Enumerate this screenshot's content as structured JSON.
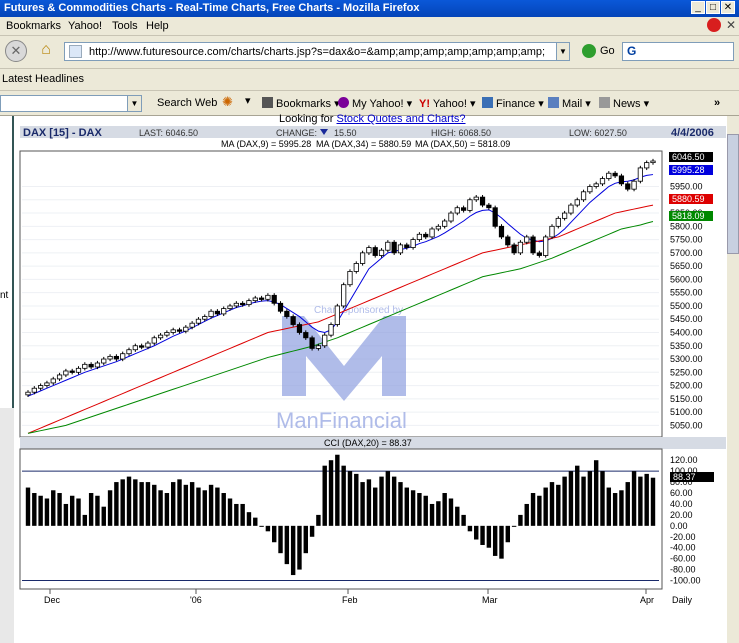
{
  "window": {
    "title": "Futures & Commodities Charts - Real-Time Charts, Free Charts - Mozilla Firefox"
  },
  "menu": {
    "items": [
      "Bookmarks",
      "Yahoo!",
      "Tools",
      "Help"
    ]
  },
  "nav": {
    "url": "http://www.futuresource.com/charts/charts.jsp?s=dax&o=&amp;amp;amp;amp;amp;amp;amp;amp;amp;a=D",
    "go_label": "Go"
  },
  "headlines": {
    "label": "Latest Headlines"
  },
  "yahoo_toolbar": {
    "search_web": "Search Web",
    "bookmarks": "Bookmarks",
    "my_yahoo": "My Yahoo!",
    "yahoo": "Yahoo!",
    "finance": "Finance",
    "mail": "Mail",
    "news": "News",
    "more": "»"
  },
  "page": {
    "looking_prefix": "Looking for",
    "looking_link": "Stock Quotes and Charts?",
    "left_fragment": "nt"
  },
  "colors": {
    "ma9": "#0000dd",
    "ma34": "#dd0000",
    "ma50": "#008800",
    "cci": "#000000",
    "watermark": "#8fa0e0"
  },
  "watermark": {
    "line1": "Chart Sponsored by",
    "line2": "ManFinancial"
  },
  "chart_data": {
    "type": "candlestick",
    "symbol": "DAX [15] - DAX",
    "last": "LAST: 6046.50",
    "change": "CHANGE:",
    "change_value": "15.50",
    "high": "HIGH: 6068.50",
    "low": "LOW: 6027.50",
    "date": "4/4/2006",
    "ma_legend": [
      {
        "label": "MA (DAX,9) = 5995.28",
        "color": "#0000dd"
      },
      {
        "label": "MA (DAX,34) = 5880.59",
        "color": "#dd0000"
      },
      {
        "label": "MA (DAX,50) = 5818.09",
        "color": "#008800"
      }
    ],
    "price_axis": [
      "5950.00",
      "5900.00",
      "5850.00",
      "5800.00",
      "5750.00",
      "5700.00",
      "5650.00",
      "5600.00",
      "5550.00",
      "5500.00",
      "5450.00",
      "5400.00",
      "5350.00",
      "5300.00",
      "5250.00",
      "5200.00",
      "5150.00",
      "5100.00",
      "5050.00"
    ],
    "price_badges": [
      {
        "label": "6046.50",
        "bg": "#000000",
        "fg": "#ffffff"
      },
      {
        "label": "5995.28",
        "bg": "#0000dd",
        "fg": "#ffffff"
      },
      {
        "label": "5880.59",
        "bg": "#dd0000",
        "fg": "#ffffff"
      },
      {
        "label": "5818.09",
        "bg": "#008800",
        "fg": "#ffffff"
      }
    ],
    "ylim": [
      5010,
      6080
    ],
    "close": [
      5175,
      5190,
      5200,
      5210,
      5225,
      5240,
      5255,
      5250,
      5265,
      5280,
      5270,
      5285,
      5300,
      5310,
      5300,
      5320,
      5335,
      5350,
      5345,
      5360,
      5380,
      5390,
      5400,
      5410,
      5405,
      5420,
      5435,
      5450,
      5460,
      5480,
      5470,
      5490,
      5500,
      5510,
      5505,
      5520,
      5530,
      5525,
      5540,
      5510,
      5480,
      5460,
      5430,
      5400,
      5380,
      5340,
      5350,
      5390,
      5430,
      5500,
      5580,
      5630,
      5660,
      5700,
      5720,
      5690,
      5710,
      5740,
      5700,
      5730,
      5720,
      5750,
      5770,
      5760,
      5790,
      5800,
      5820,
      5850,
      5870,
      5860,
      5900,
      5910,
      5880,
      5870,
      5800,
      5760,
      5730,
      5700,
      5740,
      5760,
      5700,
      5690,
      5760,
      5800,
      5830,
      5850,
      5880,
      5900,
      5930,
      5950,
      5960,
      5980,
      6000,
      5990,
      5960,
      5940,
      5970,
      6020,
      6040,
      6046
    ],
    "ma9": [
      5160,
      5170,
      5180,
      5190,
      5200,
      5210,
      5220,
      5230,
      5240,
      5250,
      5258,
      5266,
      5274,
      5282,
      5290,
      5300,
      5310,
      5320,
      5330,
      5340,
      5350,
      5362,
      5374,
      5386,
      5396,
      5406,
      5418,
      5430,
      5442,
      5454,
      5464,
      5474,
      5484,
      5494,
      5500,
      5508,
      5514,
      5518,
      5520,
      5515,
      5505,
      5490,
      5475,
      5460,
      5440,
      5420,
      5405,
      5400,
      5410,
      5440,
      5480,
      5520,
      5560,
      5600,
      5640,
      5660,
      5680,
      5700,
      5705,
      5712,
      5718,
      5725,
      5735,
      5742,
      5752,
      5762,
      5775,
      5790,
      5805,
      5820,
      5838,
      5852,
      5860,
      5862,
      5850,
      5832,
      5810,
      5790,
      5770,
      5755,
      5748,
      5742,
      5745,
      5755,
      5770,
      5790,
      5815,
      5840,
      5865,
      5890,
      5910,
      5930,
      5950,
      5962,
      5968,
      5970,
      5975,
      5985,
      5992,
      5995
    ],
    "ma34": [
      5020,
      5030,
      5040,
      5050,
      5060,
      5070,
      5080,
      5090,
      5100,
      5110,
      5120,
      5130,
      5140,
      5150,
      5160,
      5170,
      5180,
      5190,
      5200,
      5210,
      5220,
      5230,
      5240,
      5250,
      5260,
      5270,
      5280,
      5290,
      5300,
      5310,
      5320,
      5330,
      5340,
      5350,
      5360,
      5370,
      5380,
      5390,
      5400,
      5405,
      5410,
      5415,
      5420,
      5425,
      5430,
      5435,
      5440,
      5450,
      5460,
      5470,
      5480,
      5490,
      5500,
      5510,
      5520,
      5530,
      5540,
      5550,
      5560,
      5570,
      5580,
      5590,
      5600,
      5610,
      5620,
      5630,
      5640,
      5650,
      5660,
      5670,
      5680,
      5690,
      5700,
      5705,
      5710,
      5715,
      5720,
      5725,
      5730,
      5735,
      5740,
      5745,
      5750,
      5755,
      5760,
      5770,
      5780,
      5790,
      5800,
      5810,
      5820,
      5830,
      5840,
      5850,
      5855,
      5860,
      5865,
      5870,
      5875,
      5880
    ],
    "ma50": [
      5020,
      5025,
      5030,
      5035,
      5040,
      5045,
      5050,
      5058,
      5066,
      5074,
      5082,
      5090,
      5098,
      5106,
      5114,
      5122,
      5130,
      5138,
      5146,
      5154,
      5162,
      5170,
      5178,
      5186,
      5194,
      5202,
      5210,
      5218,
      5226,
      5234,
      5242,
      5250,
      5258,
      5266,
      5274,
      5282,
      5290,
      5298,
      5306,
      5312,
      5318,
      5324,
      5330,
      5336,
      5342,
      5348,
      5356,
      5364,
      5372,
      5380,
      5390,
      5400,
      5410,
      5420,
      5430,
      5440,
      5450,
      5460,
      5470,
      5480,
      5490,
      5500,
      5510,
      5520,
      5530,
      5540,
      5550,
      5560,
      5570,
      5580,
      5590,
      5600,
      5610,
      5615,
      5620,
      5625,
      5630,
      5635,
      5640,
      5648,
      5656,
      5664,
      5672,
      5680,
      5690,
      5700,
      5710,
      5720,
      5730,
      5740,
      5750,
      5760,
      5770,
      5780,
      5790,
      5795,
      5800,
      5805,
      5812,
      5818
    ],
    "cci_title": "CCI (DAX,20) = 88.37",
    "cci_axis": [
      "120.00",
      "100.00",
      "80.00",
      "60.00",
      "40.00",
      "20.00",
      "0.00",
      "-20.00",
      "-40.00",
      "-60.00",
      "-80.00",
      "-100.00"
    ],
    "cci_badge": "88.37",
    "cci_ylim": [
      -110,
      135
    ],
    "cci": [
      70,
      60,
      55,
      50,
      65,
      60,
      40,
      55,
      50,
      20,
      60,
      55,
      35,
      65,
      80,
      85,
      90,
      85,
      80,
      80,
      75,
      65,
      60,
      80,
      85,
      75,
      80,
      70,
      65,
      75,
      70,
      60,
      50,
      40,
      40,
      25,
      15,
      0,
      -10,
      -30,
      -50,
      -70,
      -90,
      -80,
      -50,
      -20,
      20,
      110,
      120,
      130,
      110,
      100,
      95,
      80,
      85,
      70,
      90,
      100,
      90,
      80,
      70,
      65,
      60,
      55,
      40,
      45,
      60,
      50,
      35,
      20,
      -10,
      -25,
      -35,
      -40,
      -55,
      -60,
      -30,
      0,
      20,
      40,
      60,
      55,
      70,
      80,
      75,
      90,
      100,
      110,
      90,
      100,
      120,
      100,
      70,
      60,
      65,
      80,
      100,
      90,
      95,
      88
    ],
    "x_labels": [
      "Dec",
      "'06",
      "Feb",
      "Mar",
      "Apr",
      "Daily"
    ]
  }
}
